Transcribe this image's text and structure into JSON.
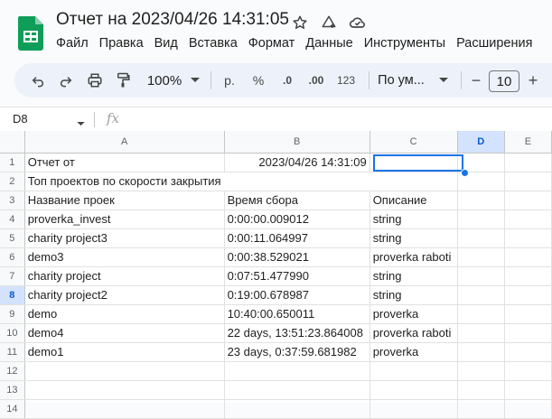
{
  "doc": {
    "title": "Отчет на 2023/04/26 14:31:05"
  },
  "menu": [
    "Файл",
    "Правка",
    "Вид",
    "Вставка",
    "Формат",
    "Данные",
    "Инструменты",
    "Расширения"
  ],
  "toolbar": {
    "zoom": "100%",
    "currency": "р.",
    "percent": "%",
    "decrease_decimals": ".0",
    "increase_decimals": ".00",
    "number_format": "123",
    "font": "По ум...",
    "font_size": "10",
    "minus": "−",
    "plus": "+"
  },
  "formula_bar": {
    "name_box": "D8",
    "fx": "fx"
  },
  "columns": [
    "A",
    "B",
    "C",
    "D",
    "E"
  ],
  "selected_column": "D",
  "selected_row": "8",
  "rows": [
    {
      "num": "1",
      "a": "Отчет от",
      "b": "2023/04/26 14:31:09",
      "c": ""
    },
    {
      "num": "2",
      "a": "Топ проектов по скорости закрытия",
      "b": "",
      "c": ""
    },
    {
      "num": "3",
      "a": "Название проек",
      "b": "Время сбора",
      "c": "Описание"
    },
    {
      "num": "4",
      "a": "proverka_invest",
      "b": "0:00:00.009012",
      "c": "string"
    },
    {
      "num": "5",
      "a": "charity project3",
      "b": "0:00:11.064997",
      "c": "string"
    },
    {
      "num": "6",
      "a": "demo3",
      "b": "0:00:38.529021",
      "c": "proverka raboti"
    },
    {
      "num": "7",
      "a": "charity project",
      "b": "0:07:51.477990",
      "c": "string"
    },
    {
      "num": "8",
      "a": "charity project2",
      "b": "0:19:00.678987",
      "c": "string"
    },
    {
      "num": "9",
      "a": "demo",
      "b": "10:40:00.650011",
      "c": "proverka"
    },
    {
      "num": "10",
      "a": "demo4",
      "b": "22 days, 13:51:23.864008",
      "c": "proverka raboti"
    },
    {
      "num": "11",
      "a": "demo1",
      "b": "23 days, 0:37:59.681982",
      "c": "proverka"
    },
    {
      "num": "12",
      "a": "",
      "b": "",
      "c": ""
    },
    {
      "num": "13",
      "a": "",
      "b": "",
      "c": ""
    },
    {
      "num": "14",
      "a": "",
      "b": "",
      "c": ""
    }
  ]
}
